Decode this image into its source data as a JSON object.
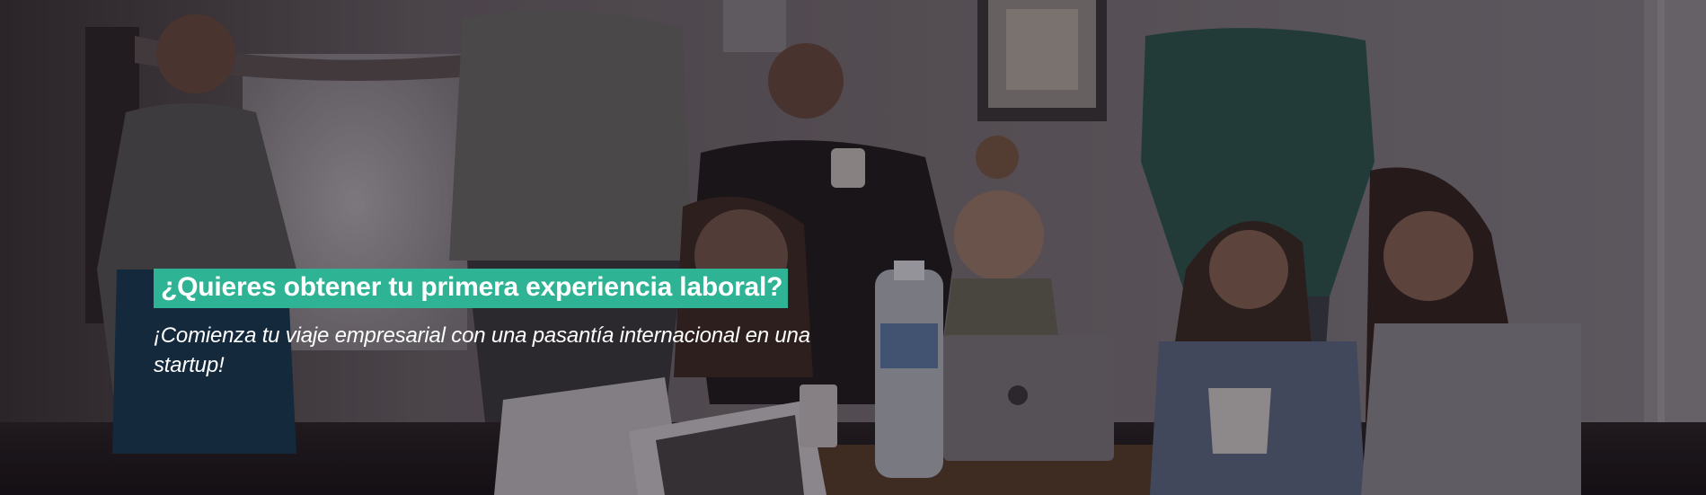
{
  "hero": {
    "headline": "¿Quieres obtener tu primera experiencia laboral?",
    "subtitle": "¡Comienza tu viaje empresarial con una pasantía internacional en una startup!",
    "accent_color": "#2eb495",
    "background_image": "team-meeting-photo"
  }
}
